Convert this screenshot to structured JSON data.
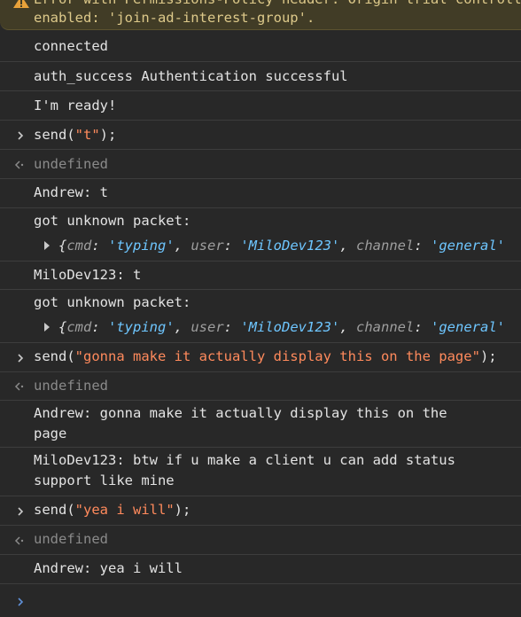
{
  "warning": {
    "line1": "Error with Permissions-Policy header: Origin trial controlled feature not",
    "line2": "enabled: 'join-ad-interest-group'."
  },
  "messages": {
    "m1": "connected",
    "m2": "auth_success Authentication successful",
    "m3": "I'm ready!",
    "cmd1_fn": "send(",
    "cmd1_str": "\"t\"",
    "cmd1_end": ");",
    "res1": "undefined",
    "m4": "Andrew: t",
    "m5": "got unknown packet:",
    "m6": "MiloDev123: t",
    "m7": "got unknown packet:",
    "cmd2_fn": "send(",
    "cmd2_str": "\"gonna make it actually display this on the page\"",
    "cmd2_end": ");",
    "res2": "undefined",
    "m8_l1": "Andrew: gonna make it actually display this on the",
    "m8_l2": "page",
    "m9_l1": "MiloDev123: btw if u make a client u can add status",
    "m9_l2": "support like mine",
    "cmd3_fn": "send(",
    "cmd3_str": "\"yea i will\"",
    "cmd3_end": ");",
    "res3": "undefined",
    "m10": "Andrew: yea i will"
  },
  "packet1": {
    "open": "{",
    "k1": "cmd",
    "v1": "'typing'",
    "k2": "user",
    "v2": "'MiloDev123'",
    "k3": "channel",
    "v3": "'general'",
    "colon": ": ",
    "comma": ", "
  },
  "packet2": {
    "open": "{",
    "k1": "cmd",
    "v1": "'typing'",
    "k2": "user",
    "v2": "'MiloDev123'",
    "k3": "channel",
    "v3": "'general'",
    "colon": ": ",
    "comma": ", "
  },
  "colors": {
    "background": "#282828",
    "string": "#ff8a5c",
    "object_value": "#6ec6ff",
    "muted": "#8a8a8a",
    "warning_bg": "#413c26"
  }
}
